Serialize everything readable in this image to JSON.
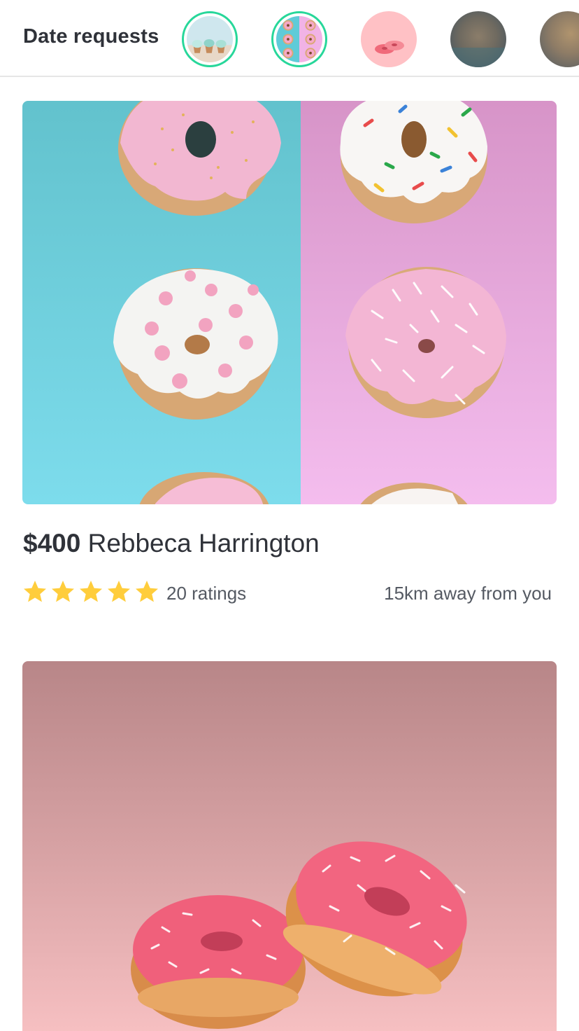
{
  "header": {
    "title": "Date requests",
    "avatars": [
      {
        "label": "cupcakes-avatar",
        "active": true
      },
      {
        "label": "donuts-grid-avatar",
        "active": true
      },
      {
        "label": "pink-donuts-avatar",
        "active": false
      },
      {
        "label": "blurred-avatar",
        "active": false
      },
      {
        "label": "blurred-avatar-partial",
        "active": false
      }
    ]
  },
  "cards": [
    {
      "price": "$400",
      "name": "Rebbeca Harrington",
      "rating_stars": 5,
      "ratings_label": "20 ratings",
      "distance": "15km away from you"
    },
    {
      "price": "",
      "name": ""
    }
  ],
  "colors": {
    "accent_ring": "#27d79a",
    "star": "#ffcd3c",
    "text_dark": "#2f3239",
    "text_muted": "#555a63"
  }
}
